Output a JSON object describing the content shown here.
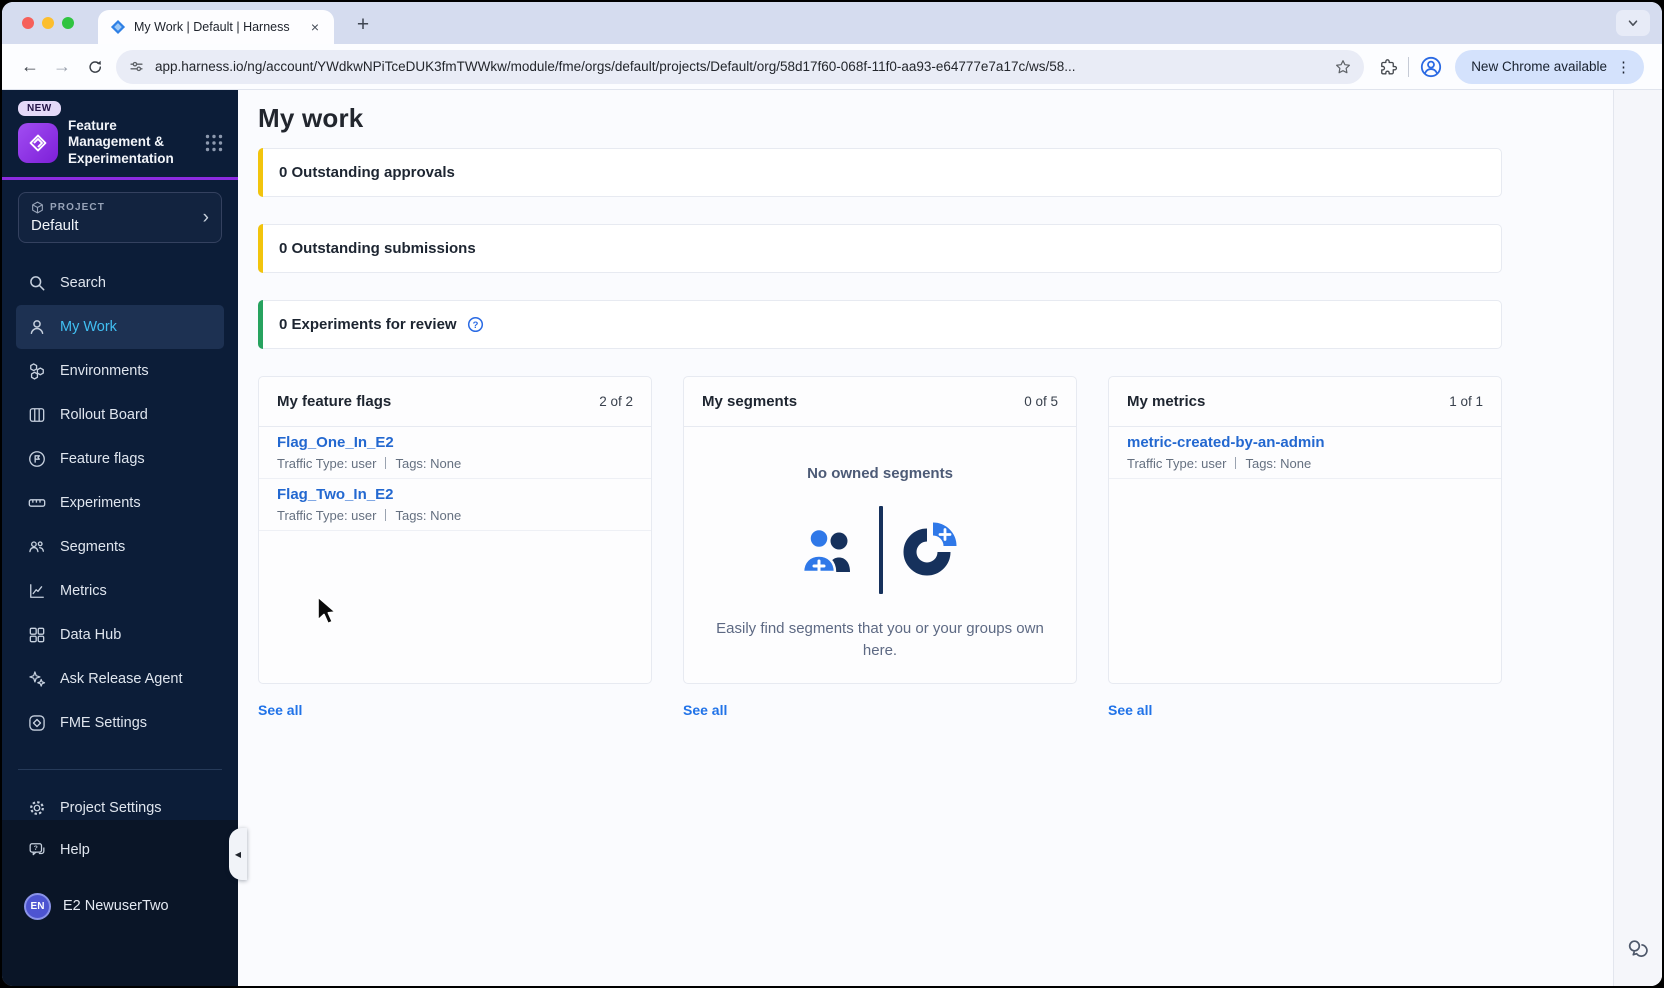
{
  "colors": {
    "brand_purple": "#8c2be0",
    "sidebar_bg": "#0c1d38",
    "active_nav_text": "#41bff2",
    "link_blue": "#2368d0",
    "see_all_blue": "#2173e8",
    "banner_yellow": "#f2c40d",
    "banner_green": "#27a35f",
    "update_pill_bg": "#d4e2fc",
    "avatar_bg": "#4d54d1",
    "empty_icon_navy": "#16315c",
    "empty_icon_blue": "#2f78e8"
  },
  "browser": {
    "tab_title": "My Work | Default | Harness",
    "url": "app.harness.io/ng/account/YWdkwNPiTceDUK3fmTWWkw/module/fme/orgs/default/projects/Default/org/58d17f60-068f-11f0-aa93-e64777e7a17c/ws/58...",
    "update_button": "New Chrome available",
    "glyphs": {
      "close_tab": "×",
      "new_tab": "+",
      "kebab": "⋮",
      "back": "←",
      "forward": "→"
    }
  },
  "sidebar": {
    "new_badge": "NEW",
    "product_name": "Feature Management & Experimentation",
    "project_label": "PROJECT",
    "project_name": "Default",
    "project_chevron": "›",
    "collapse_glyph": "◀",
    "nav": [
      {
        "label": "Search",
        "icon": "search-icon"
      },
      {
        "label": "My Work",
        "icon": "user-icon",
        "active": true
      },
      {
        "label": "Environments",
        "icon": "environments-icon"
      },
      {
        "label": "Rollout Board",
        "icon": "board-columns-icon"
      },
      {
        "label": "Feature flags",
        "icon": "flag-circle-icon"
      },
      {
        "label": "Experiments",
        "icon": "ruler-icon"
      },
      {
        "label": "Segments",
        "icon": "people-icon"
      },
      {
        "label": "Metrics",
        "icon": "line-chart-icon"
      },
      {
        "label": "Data Hub",
        "icon": "grid-squares-icon"
      },
      {
        "label": "Ask Release Agent",
        "icon": "sparkles-icon"
      },
      {
        "label": "FME Settings",
        "icon": "fme-diamond-icon"
      }
    ],
    "project_settings": "Project Settings",
    "help_label": "Help",
    "user": {
      "initials": "EN",
      "name": "E2 NewuserTwo"
    }
  },
  "main": {
    "title": "My work",
    "banners": [
      {
        "text": "0 Outstanding approvals",
        "accent": "#f2c40d"
      },
      {
        "text": "0 Outstanding submissions",
        "accent": "#f2c40d"
      },
      {
        "text": "0 Experiments for review",
        "accent": "#27a35f",
        "has_help_icon": true
      }
    ],
    "cards": [
      {
        "title": "My feature flags",
        "count": "2 of 2",
        "items": [
          {
            "name": "Flag_One_In_E2",
            "traffic": "Traffic Type: user",
            "tags": "Tags: None"
          },
          {
            "name": "Flag_Two_In_E2",
            "traffic": "Traffic Type: user",
            "tags": "Tags: None"
          }
        ],
        "see_all": "See all"
      },
      {
        "title": "My segments",
        "count": "0 of 5",
        "empty": {
          "title": "No owned segments",
          "description": "Easily find segments that you or your groups own here."
        },
        "see_all": "See all"
      },
      {
        "title": "My metrics",
        "count": "1 of 1",
        "items": [
          {
            "name": "metric-created-by-an-admin",
            "traffic": "Traffic Type: user",
            "tags": "Tags: None"
          }
        ],
        "see_all": "See all"
      }
    ]
  }
}
